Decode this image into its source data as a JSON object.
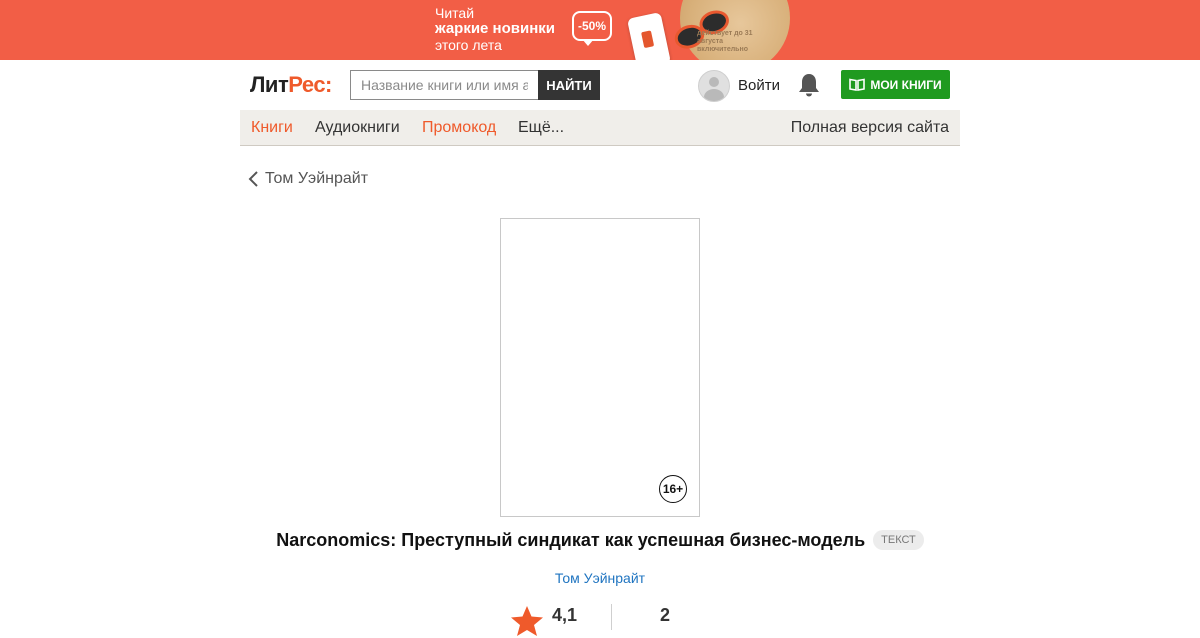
{
  "promo": {
    "line1": "Читай",
    "line2": "жаркие новинки",
    "line3": "этого лета",
    "discount": "-50%",
    "fine_print": "действует до 31 августа включительно",
    "colors": {
      "background": "#f25e46"
    }
  },
  "header": {
    "logo_main": "Лит",
    "logo_accent": "Рес:",
    "search": {
      "placeholder": "Название книги или имя автора",
      "value": ""
    },
    "search_button": "НАЙТИ",
    "login": "Войти",
    "bell_icon": "bell-icon",
    "my_books_button": "МОИ КНИГИ",
    "my_books_icon": "open-book-icon",
    "colors": {
      "brand_orange": "#ef5a2b",
      "green": "#1f9a1f"
    }
  },
  "nav": {
    "items": [
      {
        "label": "Книги",
        "active": true
      },
      {
        "label": "Аудиокниги",
        "active": false
      },
      {
        "label": "Промокод",
        "active": true
      },
      {
        "label": "Ещё...",
        "active": false
      }
    ],
    "full_version": "Полная версия сайта"
  },
  "breadcrumb": {
    "back_label": "Том Уэйнрайт",
    "icon": "chevron-left-icon"
  },
  "book": {
    "age_rating": "16+",
    "title": "Narconomics: Преступный синдикат как успешная бизнес-модель",
    "type": "ТЕКСТ",
    "author": "Том Уэйнрайт",
    "rating": "4,1",
    "rating_icon": "star-icon",
    "count": "2"
  }
}
